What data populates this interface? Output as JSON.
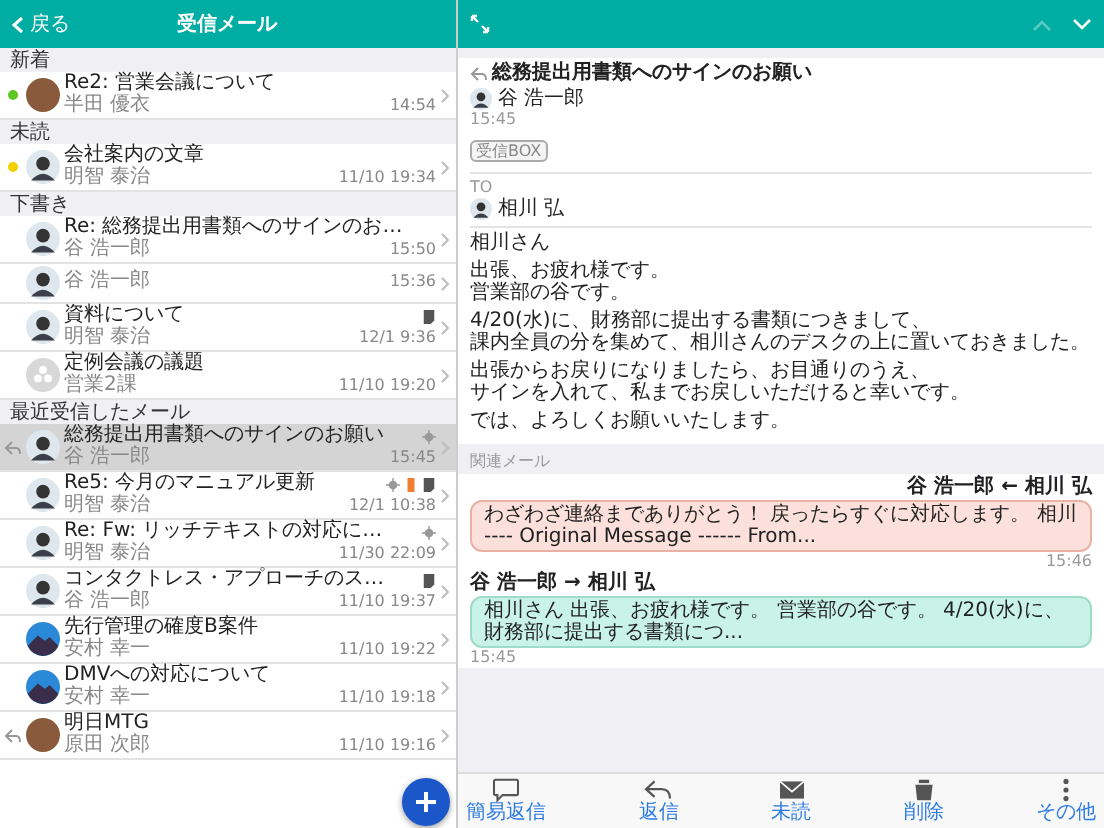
{
  "list_header": {
    "back_label": "戻る",
    "title": "受信メール"
  },
  "sections": [
    {
      "title": "新着",
      "items": [
        {
          "title": "Re2: 営業会議について",
          "sender": "半田 優衣",
          "time": "14:54",
          "avatar": {
            "kind": "photo"
          },
          "color": "#5ec622",
          "replied": false,
          "selected": false
        }
      ]
    },
    {
      "title": "未読",
      "items": [
        {
          "title": "会社案内の文章",
          "sender": "明智 泰治",
          "time": "11/10 19:34",
          "avatar": {
            "kind": "person"
          },
          "color": "#f5d000",
          "replied": false,
          "selected": false
        }
      ]
    },
    {
      "title": "下書き",
      "items": [
        {
          "title": "Re: 総務提出用書類へのサインのお…",
          "sender": "谷 浩一郎",
          "time": "15:50",
          "avatar": {
            "kind": "person"
          },
          "replied": false,
          "selected": false
        },
        {
          "sender": "谷 浩一郎",
          "time": "15:36",
          "avatar": {
            "kind": "person"
          },
          "replied": false,
          "selected": false
        },
        {
          "title": "資料について",
          "sender": "明智 泰治",
          "time": "12/1 9:36",
          "avatar": {
            "kind": "person"
          },
          "replied": false,
          "selected": false,
          "marks": [
            {
              "kind": "note"
            }
          ]
        },
        {
          "title": "定例会議の議題",
          "sender": "営業2課",
          "time": "11/10 19:20",
          "avatar": {
            "kind": "group"
          },
          "replied": false,
          "selected": false
        }
      ]
    },
    {
      "title": "最近受信したメール",
      "items": [
        {
          "title": "総務提出用書類へのサインのお願い",
          "sender": "谷 浩一郎",
          "time": "15:45",
          "avatar": {
            "kind": "person"
          },
          "replied": true,
          "selected": true,
          "marks": [
            {
              "kind": "pin"
            }
          ]
        },
        {
          "title": "Re5: 今月のマニュアル更新",
          "sender": "明智 泰治",
          "time": "12/1 10:38",
          "avatar": {
            "kind": "person"
          },
          "replied": false,
          "selected": false,
          "marks": [
            {
              "kind": "pin"
            },
            {
              "kind": "flag"
            },
            {
              "kind": "note"
            }
          ]
        },
        {
          "title": "Re: Fw: リッチテキストの対応に…",
          "sender": "明智 泰治",
          "time": "11/30 22:09",
          "avatar": {
            "kind": "person"
          },
          "replied": false,
          "selected": false,
          "marks": [
            {
              "kind": "pin"
            }
          ]
        },
        {
          "title": "コンタクトレス・アプローチのス…",
          "sender": "谷 浩一郎",
          "time": "11/10 19:37",
          "avatar": {
            "kind": "person"
          },
          "replied": false,
          "selected": false,
          "marks": [
            {
              "kind": "note"
            }
          ]
        },
        {
          "title": "先行管理の確度B案件",
          "sender": "安村 幸一",
          "time": "11/10 19:22",
          "avatar": {
            "kind": "landscape"
          },
          "replied": false,
          "selected": false
        },
        {
          "title": "DMVへの対応について",
          "sender": "安村 幸一",
          "time": "11/10 19:18",
          "avatar": {
            "kind": "landscape"
          },
          "replied": false,
          "selected": false
        },
        {
          "title": "明日MTG",
          "sender": "原田 次郎",
          "time": "11/10 19:16",
          "avatar": {
            "kind": "photo"
          },
          "replied": true,
          "selected": false
        }
      ]
    }
  ],
  "detail_nav": {
    "previous_disabled": true,
    "next_disabled": false
  },
  "message": {
    "subject": "総務提出用書類へのサインのお願い",
    "replied": true,
    "sender": "谷 浩一郎",
    "time": "15:45",
    "folder": "受信BOX",
    "to_label": "TO",
    "recipient": "相川 弘",
    "body": [
      [
        "相川さん"
      ],
      [
        "出張、お疲れ様です。",
        "営業部の谷です。"
      ],
      [
        "4/20(水)に、財務部に提出する書類につきまして、",
        "課内全員の分を集めて、相川さんのデスクの上に置いておきました。"
      ],
      [
        "出張からお戻りになりましたら、お目通りのうえ、",
        "サインを入れて、私までお戻しいただけると幸いです。"
      ],
      [
        "では、よろしくお願いいたします。"
      ]
    ]
  },
  "related": {
    "title": "関連メール",
    "messages": [
      {
        "kind": "incoming",
        "header": "谷 浩一郎 ← 相川 弘",
        "text": "わざわざ連絡までありがとう！ 戻ったらすぐに対応します。 相川 ---- Original Message ------ From...",
        "time": "15:46"
      },
      {
        "kind": "outgoing",
        "header": "谷 浩一郎 → 相川 弘",
        "text": "相川さん 出張、お疲れ様です。 営業部の谷です。 4/20(水)に、財務部に提出する書類につ...",
        "time": "15:45"
      }
    ]
  },
  "toolbar": [
    {
      "kind": "quick-reply",
      "label": "簡易返信"
    },
    {
      "kind": "reply",
      "label": "返信"
    },
    {
      "kind": "unread",
      "label": "未読"
    },
    {
      "kind": "delete",
      "label": "削除"
    },
    {
      "kind": "more",
      "label": "その他"
    }
  ]
}
